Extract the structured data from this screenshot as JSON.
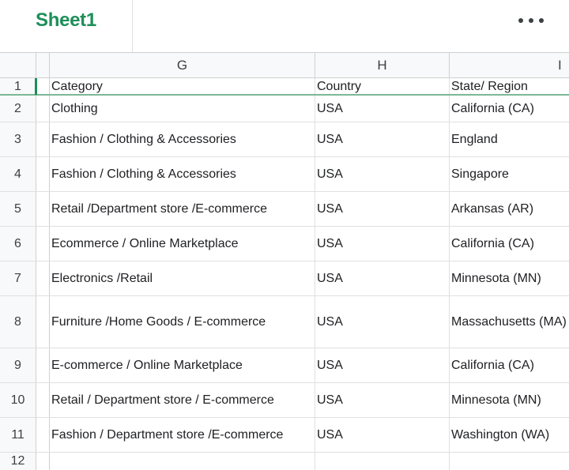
{
  "sheet": {
    "tab_label": "Sheet1",
    "more_icon": "more-horizontal-icon"
  },
  "columns": [
    {
      "letter": "G"
    },
    {
      "letter": "H"
    },
    {
      "letter": "I"
    }
  ],
  "rows": [
    {
      "num": "1",
      "g": "Category",
      "h": "Country",
      "i": "State/ Region"
    },
    {
      "num": "2",
      "g": "Clothing",
      "h": "USA",
      "i": "California (CA)"
    },
    {
      "num": "3",
      "g": "Fashion / Clothing & Accessories",
      "h": "USA",
      "i": "England"
    },
    {
      "num": "4",
      "g": "Fashion / Clothing & Accessories",
      "h": "USA",
      "i": "Singapore"
    },
    {
      "num": "5",
      "g": "Retail /Department store /E-commerce",
      "h": "USA",
      "i": "Arkansas (AR)"
    },
    {
      "num": "6",
      "g": "Ecommerce / Online Marketplace",
      "h": "USA",
      "i": "California (CA)"
    },
    {
      "num": "7",
      "g": "Electronics /Retail",
      "h": "USA",
      "i": "Minnesota (MN)"
    },
    {
      "num": "8",
      "g": "Furniture /Home Goods / E-commerce",
      "h": "USA",
      "i": "Massachusetts (MA)"
    },
    {
      "num": "9",
      "g": "E-commerce / Online Marketplace",
      "h": "USA",
      "i": "California (CA)"
    },
    {
      "num": "10",
      "g": "Retail / Department store / E-commerce",
      "h": "USA",
      "i": "Minnesota (MN)"
    },
    {
      "num": "11",
      "g": "Fashion / Department store /E-commerce",
      "h": "USA",
      "i": "Washington (WA)"
    },
    {
      "num": "12",
      "g": "",
      "h": "",
      "i": ""
    }
  ],
  "colors": {
    "accent": "#1e8e5a",
    "header_bg": "#f8f9fa",
    "grid_line": "#e0e0e0"
  }
}
